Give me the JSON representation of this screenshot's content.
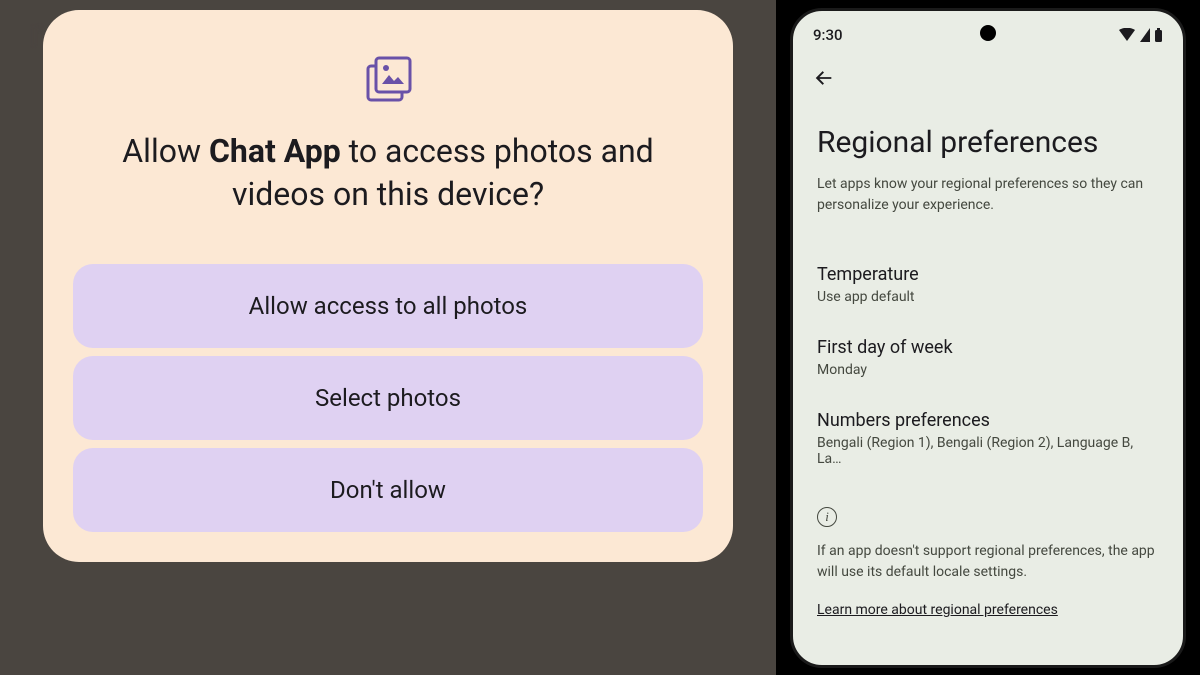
{
  "dialog": {
    "title_prefix": "Allow ",
    "app_name": "Chat App",
    "title_suffix": " to access photos and videos on this device?",
    "options": {
      "allow_all": "Allow access to all photos",
      "select": "Select photos",
      "deny": "Don't allow"
    }
  },
  "phone": {
    "status": {
      "time": "9:30"
    },
    "page": {
      "title": "Regional preferences",
      "subtitle": "Let apps know your regional preferences so they can personalize your experience."
    },
    "preferences": {
      "temperature": {
        "label": "Temperature",
        "value": "Use app default"
      },
      "first_day": {
        "label": "First day of week",
        "value": "Monday"
      },
      "numbers": {
        "label": "Numbers preferences",
        "value": "Bengali (Region 1), Bengali (Region 2), Language B, La…"
      }
    },
    "info": {
      "text": "If an app doesn't support regional preferences, the app will use its default locale settings.",
      "learn_more": "Learn more about regional preferences"
    }
  }
}
